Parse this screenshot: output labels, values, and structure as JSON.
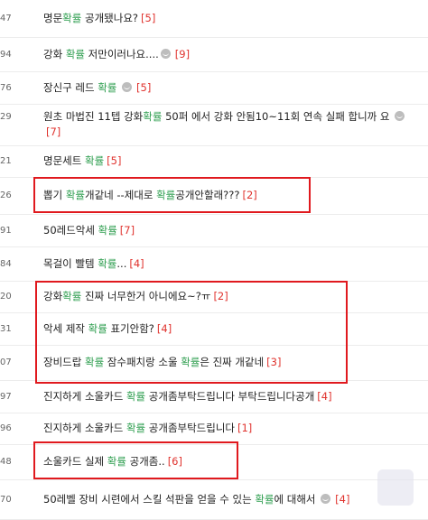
{
  "rows": [
    {
      "num": "47",
      "parts": [
        {
          "t": "명문"
        },
        {
          "t": "확률",
          "hl": true
        },
        {
          "t": " 공개됐나요?"
        }
      ],
      "count": "[5]"
    },
    {
      "num": "94",
      "parts": [
        {
          "t": "강화 "
        },
        {
          "t": "확률",
          "hl": true
        },
        {
          "t": " 저만이러나요....",
          "emo": true
        }
      ],
      "count": "[9]"
    },
    {
      "num": "76",
      "parts": [
        {
          "t": "장신구 레드 "
        },
        {
          "t": "확률",
          "hl": true
        },
        {
          "t": " ",
          "emo": true
        }
      ],
      "count": "[5]"
    },
    {
      "num": "29",
      "parts": [
        {
          "t": "원초 마법진 11텝 강화"
        },
        {
          "t": "확률",
          "hl": true
        },
        {
          "t": " 50퍼 에서 강화 안됨10~11회 연속 실패 합니까 요 ",
          "emo": true
        }
      ],
      "count": "[7]",
      "wrap": true
    },
    {
      "num": "21",
      "parts": [
        {
          "t": "명문세트 "
        },
        {
          "t": "확률",
          "hl": true
        }
      ],
      "count": "[5]"
    },
    {
      "num": "26",
      "parts": [
        {
          "t": "뽑기 "
        },
        {
          "t": "확률",
          "hl": true
        },
        {
          "t": "개같네 --제대로 "
        },
        {
          "t": "확률",
          "hl": true
        },
        {
          "t": "공개안할래???"
        }
      ],
      "count": "[2]"
    },
    {
      "num": "91",
      "parts": [
        {
          "t": "50레드악세 "
        },
        {
          "t": "확률",
          "hl": true
        }
      ],
      "count": "[7]"
    },
    {
      "num": "84",
      "parts": [
        {
          "t": "목걸이 빨템 "
        },
        {
          "t": "확률",
          "hl": true
        },
        {
          "t": "..."
        }
      ],
      "count": "[4]"
    },
    {
      "num": "20",
      "parts": [
        {
          "t": "강화"
        },
        {
          "t": "확률",
          "hl": true
        },
        {
          "t": " 진짜 너무한거 아니에요~?ㅠ"
        }
      ],
      "count": "[2]"
    },
    {
      "num": "31",
      "parts": [
        {
          "t": "악세 제작 "
        },
        {
          "t": "확률",
          "hl": true
        },
        {
          "t": " 표기안함?"
        }
      ],
      "count": "[4]"
    },
    {
      "num": "07",
      "parts": [
        {
          "t": "장비드랍 "
        },
        {
          "t": "확률",
          "hl": true
        },
        {
          "t": " 잠수패치랑 소울 "
        },
        {
          "t": "확률",
          "hl": true
        },
        {
          "t": "은 진짜 개같네"
        }
      ],
      "count": "[3]"
    },
    {
      "num": "97",
      "parts": [
        {
          "t": "진지하게 소울카드 "
        },
        {
          "t": "확률",
          "hl": true
        },
        {
          "t": " 공개좀부탁드립니다 부탁드립니다공개"
        }
      ],
      "count": "[4]"
    },
    {
      "num": "96",
      "parts": [
        {
          "t": "진지하게 소울카드 "
        },
        {
          "t": "확률",
          "hl": true
        },
        {
          "t": " 공개좀부탁드립니다"
        }
      ],
      "count": "[1]"
    },
    {
      "num": "48",
      "parts": [
        {
          "t": "소울카드 실제 "
        },
        {
          "t": "확률",
          "hl": true
        },
        {
          "t": " 공개좀.."
        }
      ],
      "count": "[6]"
    },
    {
      "num": "70",
      "parts": [
        {
          "t": "50레벨 장비 시련에서 스킬 석판을 얻을 수 있는 "
        },
        {
          "t": "확률",
          "hl": true
        },
        {
          "t": "에 대해서 ",
          "emo": true
        }
      ],
      "count": "[4]"
    }
  ]
}
